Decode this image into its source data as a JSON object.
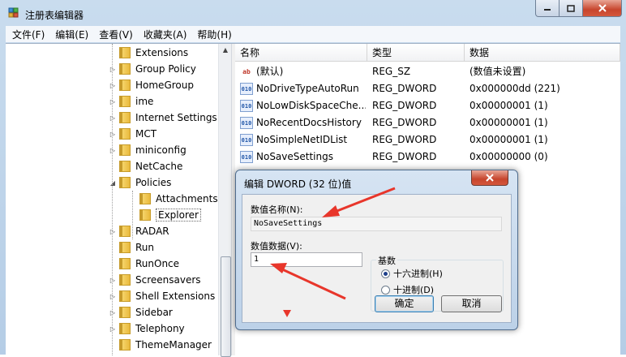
{
  "window": {
    "title": "注册表编辑器",
    "menu": [
      "文件(F)",
      "编辑(E)",
      "查看(V)",
      "收藏夹(A)",
      "帮助(H)"
    ]
  },
  "tree": {
    "items": [
      {
        "label": "Extensions",
        "expandable": false
      },
      {
        "label": "Group Policy",
        "expandable": true
      },
      {
        "label": "HomeGroup",
        "expandable": true
      },
      {
        "label": "ime",
        "expandable": true
      },
      {
        "label": "Internet Settings",
        "expandable": true
      },
      {
        "label": "MCT",
        "expandable": true
      },
      {
        "label": "miniconfig",
        "expandable": true
      },
      {
        "label": "NetCache",
        "expandable": false
      },
      {
        "label": "Policies",
        "expandable": true,
        "expanded": true
      },
      {
        "label": "Attachments",
        "expandable": false,
        "child": true
      },
      {
        "label": "Explorer",
        "expandable": false,
        "child": true,
        "selected": true
      },
      {
        "label": "RADAR",
        "expandable": true
      },
      {
        "label": "Run",
        "expandable": false
      },
      {
        "label": "RunOnce",
        "expandable": false
      },
      {
        "label": "Screensavers",
        "expandable": true
      },
      {
        "label": "Shell Extensions",
        "expandable": true
      },
      {
        "label": "Sidebar",
        "expandable": true
      },
      {
        "label": "Telephony",
        "expandable": true
      },
      {
        "label": "ThemeManager",
        "expandable": false
      }
    ]
  },
  "list": {
    "columns": [
      "名称",
      "类型",
      "数据"
    ],
    "rows": [
      {
        "icon": "ab",
        "name": "(默认)",
        "type": "REG_SZ",
        "data": "(数值未设置)"
      },
      {
        "icon": "010",
        "name": "NoDriveTypeAutoRun",
        "type": "REG_DWORD",
        "data": "0x000000dd (221)"
      },
      {
        "icon": "010",
        "name": "NoLowDiskSpaceChe...",
        "type": "REG_DWORD",
        "data": "0x00000001 (1)"
      },
      {
        "icon": "010",
        "name": "NoRecentDocsHistory",
        "type": "REG_DWORD",
        "data": "0x00000001 (1)"
      },
      {
        "icon": "010",
        "name": "NoSimpleNetIDList",
        "type": "REG_DWORD",
        "data": "0x00000001 (1)"
      },
      {
        "icon": "010",
        "name": "NoSaveSettings",
        "type": "REG_DWORD",
        "data": "0x00000000 (0)"
      }
    ]
  },
  "dialog": {
    "title": "编辑 DWORD (32 位)值",
    "name_label": "数值名称(N):",
    "name_value": "NoSaveSettings",
    "data_label": "数值数据(V):",
    "data_value": "1",
    "base_label": "基数",
    "radio_hex": "十六进制(H)",
    "radio_dec": "十进制(D)",
    "selected_base": "hex",
    "ok": "确定",
    "cancel": "取消"
  },
  "colors": {
    "annotation_arrow": "#e8362b",
    "close_button": "#c7452d",
    "selection": "#3399ff"
  }
}
